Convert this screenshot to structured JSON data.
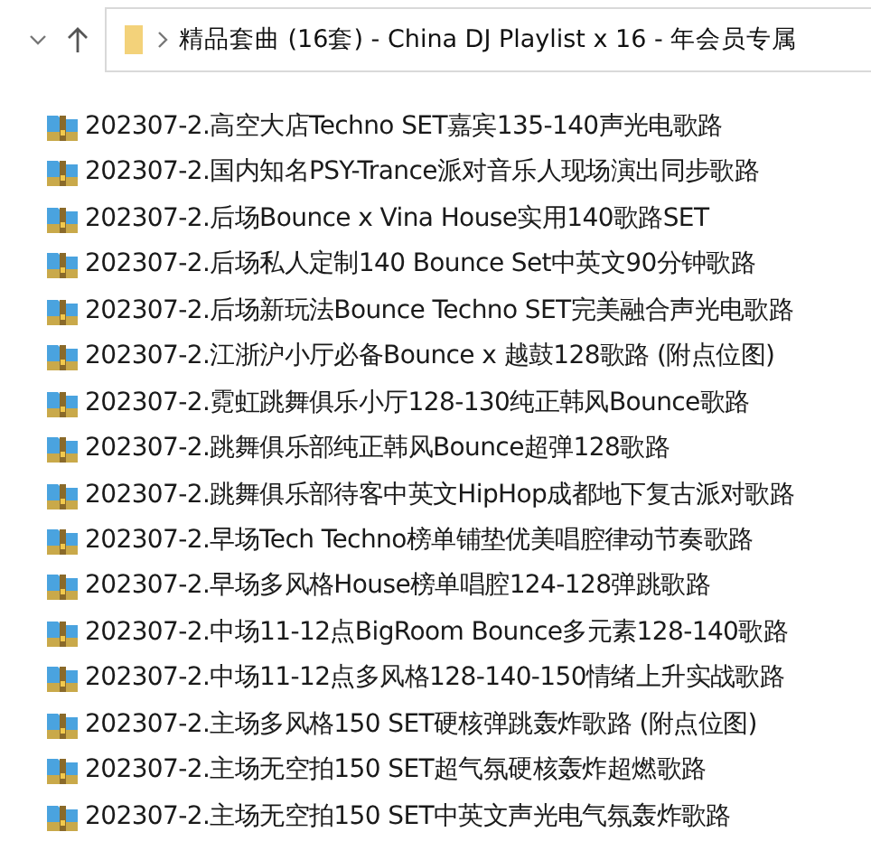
{
  "address_bar": {
    "path": "精品套曲 (16套) - China DJ Playlist x 16 - 年会员专属"
  },
  "files": [
    {
      "name": "202307-2.高空大店Techno SET嘉宾135-140声光电歌路"
    },
    {
      "name": "202307-2.国内知名PSY-Trance派对音乐人现场演出同步歌路"
    },
    {
      "name": "202307-2.后场Bounce x Vina House实用140歌路SET"
    },
    {
      "name": "202307-2.后场私人定制140 Bounce Set中英文90分钟歌路"
    },
    {
      "name": "202307-2.后场新玩法Bounce Techno SET完美融合声光电歌路"
    },
    {
      "name": "202307-2.江浙沪小厅必备Bounce x 越鼓128歌路 (附点位图)"
    },
    {
      "name": "202307-2.霓虹跳舞俱乐小厅128-130纯正韩风Bounce歌路"
    },
    {
      "name": "202307-2.跳舞俱乐部纯正韩风Bounce超弹128歌路"
    },
    {
      "name": "202307-2.跳舞俱乐部待客中英文HipHop成都地下复古派对歌路"
    },
    {
      "name": "202307-2.早场Tech Techno榜单铺垫优美唱腔律动节奏歌路"
    },
    {
      "name": "202307-2.早场多风格House榜单唱腔124-128弹跳歌路"
    },
    {
      "name": "202307-2.中场11-12点BigRoom Bounce多元素128-140歌路"
    },
    {
      "name": "202307-2.中场11-12点多风格128-140-150情绪上升实战歌路"
    },
    {
      "name": "202307-2.主场多风格150 SET硬核弹跳轰炸歌路 (附点位图)"
    },
    {
      "name": "202307-2.主场无空拍150 SET超气氛硬核轰炸超燃歌路"
    },
    {
      "name": "202307-2.主场无空拍150 SET中英文声光电气氛轰炸歌路"
    }
  ]
}
